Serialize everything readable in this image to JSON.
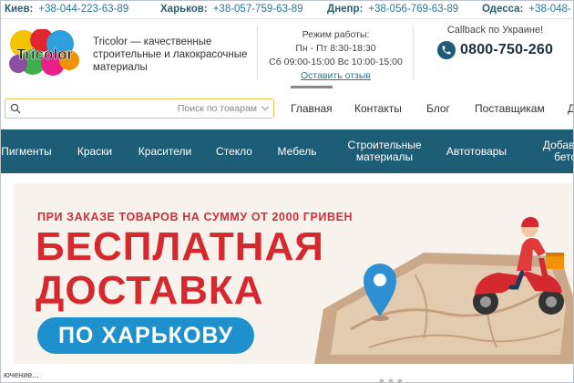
{
  "phones": [
    {
      "city": "Киев:",
      "number": "+38-044-223-63-89"
    },
    {
      "city": "Харьков:",
      "number": "+38-057-759-63-89"
    },
    {
      "city": "Днепр:",
      "number": "+38-056-769-63-89"
    },
    {
      "city": "Одесса:",
      "number": "+38-048-"
    }
  ],
  "header": {
    "logo_text": "Tricolor",
    "tagline": "Tricolor — качественные строительные и лакокрасочные материалы",
    "hours_title": "Режим работы:",
    "hours_weekdays": "Пн - Пт 8:30-18:30",
    "hours_weekend": "Сб 09:00-15:00 Вс 10:00-15:00",
    "review_link": "Оставить отзыв",
    "callback_label": "Callback по Украине!",
    "callback_phone": "0800-750-260"
  },
  "search": {
    "placeholder": "Поиск по товарам"
  },
  "topnav": [
    "Главная",
    "Контакты",
    "Блог",
    "Поставщикам",
    "Д"
  ],
  "categories": [
    "Пигменты",
    "Краски",
    "Красители",
    "Стекло",
    "Мебель",
    "Строительные материалы",
    "Автотовары",
    "Добавки в бетон"
  ],
  "banner": {
    "top_line": "ПРИ ЗАКАЗЕ ТОВАРОВ НА СУММУ ОТ 2000 ГРИВЕН",
    "headline_1": "БЕСПЛАТНАЯ",
    "headline_2": "ДОСТАВКА",
    "pill": "ПО ХАРЬКОВУ"
  },
  "status": "ючение...",
  "colors": {
    "menu_bg": "#1d5d75",
    "accent_red": "#d6282f",
    "pill_blue": "#1e90cc",
    "link": "#2a7890"
  }
}
